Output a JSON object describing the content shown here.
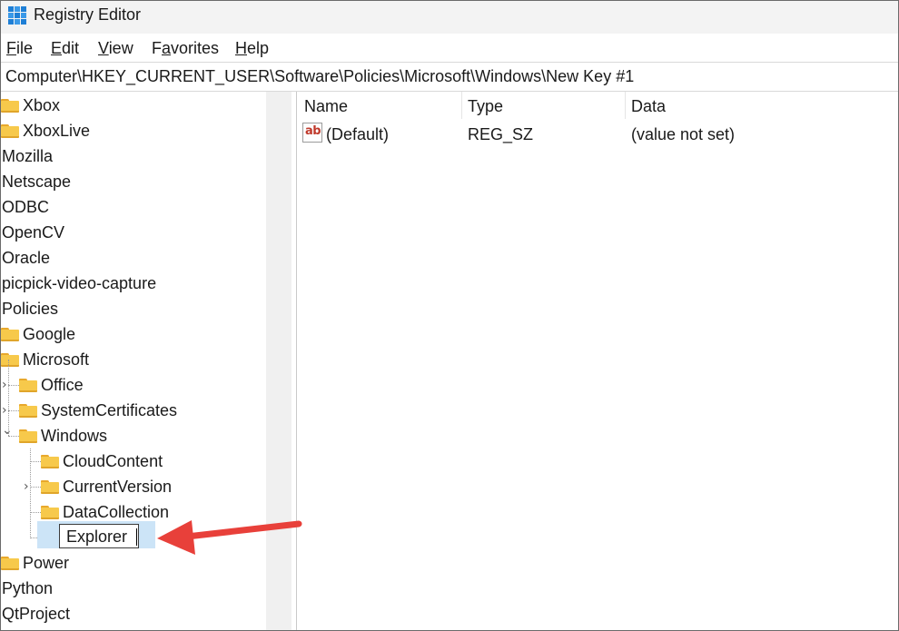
{
  "window": {
    "title": "Registry Editor"
  },
  "menu": [
    {
      "label": "File",
      "key": "F",
      "rest": "ile"
    },
    {
      "label": "Edit",
      "key": "E",
      "rest": "dit"
    },
    {
      "label": "View",
      "key": "V",
      "rest": "iew"
    },
    {
      "label": "Favorites",
      "key": "F",
      "pre": "",
      "rest": "avorites",
      "underline_index": 2
    },
    {
      "label": "Help",
      "key": "H",
      "rest": "elp"
    }
  ],
  "address": {
    "path": "Computer\\HKEY_CURRENT_USER\\Software\\Policies\\Microsoft\\Windows\\New Key #1"
  },
  "tree": {
    "items": [
      {
        "label": "Xbox",
        "folder": true
      },
      {
        "label": "XboxLive",
        "folder": true
      },
      {
        "label": "Mozilla",
        "folder": false
      },
      {
        "label": "Netscape",
        "folder": false
      },
      {
        "label": "ODBC",
        "folder": false
      },
      {
        "label": "OpenCV",
        "folder": false
      },
      {
        "label": "Oracle",
        "folder": false
      },
      {
        "label": "picpick-video-capture",
        "folder": false
      },
      {
        "label": "Policies",
        "folder": false
      },
      {
        "label": "Google",
        "folder": true
      },
      {
        "label": "Microsoft",
        "folder": true
      },
      {
        "label": "Office",
        "folder": true,
        "expander": "collapsed"
      },
      {
        "label": "SystemCertificates",
        "folder": true,
        "expander": "collapsed"
      },
      {
        "label": "Windows",
        "folder": true,
        "expander": "expanded"
      },
      {
        "label": "CloudContent",
        "folder": true
      },
      {
        "label": "CurrentVersion",
        "folder": true,
        "expander": "collapsed"
      },
      {
        "label": "DataCollection",
        "folder": true
      },
      {
        "label": "",
        "folder": true
      },
      {
        "label": "Power",
        "folder": true
      },
      {
        "label": "Python",
        "folder": false
      },
      {
        "label": "QtProject",
        "folder": false
      }
    ],
    "rename_value": "Explorer"
  },
  "list": {
    "columns": [
      "Name",
      "Type",
      "Data"
    ],
    "rows": [
      {
        "name": "(Default)",
        "type": "REG_SZ",
        "data": "(value not set)",
        "icon": "string-value-icon"
      }
    ]
  },
  "colors": {
    "arrow": "#e8403a",
    "selection": "#cce4f7",
    "folder": "#f7c94b"
  }
}
